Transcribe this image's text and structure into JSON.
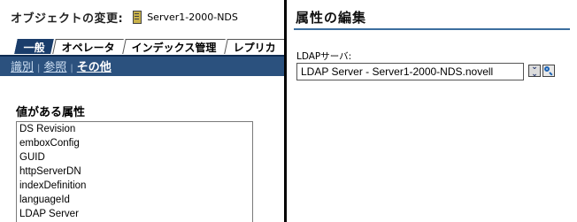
{
  "header": {
    "label": "オブジェクトの変更:",
    "object_name": "Server1-2000-NDS"
  },
  "tabs": [
    {
      "label": "一般",
      "active": true
    },
    {
      "label": "オペレータ",
      "active": false
    },
    {
      "label": "インデックス管理",
      "active": false
    },
    {
      "label": "レプリカ",
      "active": false
    }
  ],
  "subnav": {
    "items": [
      "識別",
      "参照"
    ],
    "current": "その他",
    "separator": "|"
  },
  "attributes": {
    "title": "値がある属性",
    "items": [
      "DS Revision",
      "emboxConfig",
      "GUID",
      "httpServerDN",
      "indexDefinition",
      "languageId",
      "LDAP Server"
    ]
  },
  "edit_panel": {
    "title": "属性の編集",
    "field_label": "LDAPサーバ:",
    "field_value": "LDAP Server - Server1-2000-NDS.novell"
  },
  "icons": {
    "object": "server-icon",
    "browse": "chevron-down-icon",
    "search": "search-icon"
  },
  "colors": {
    "accent": "#1a3d6b",
    "subnav_bg": "#2b517e",
    "underline": "#3c6e9f"
  }
}
